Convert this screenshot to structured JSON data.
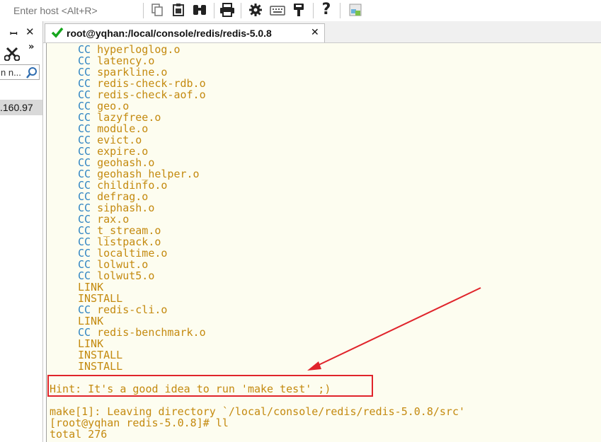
{
  "toolbar": {
    "host_placeholder": "Enter host <Alt+R>",
    "buttons": [
      "copy-icon",
      "paste-icon",
      "find-icon",
      "print-icon",
      "settings-icon",
      "keyboard-icon",
      "keymap-icon",
      "help-icon",
      "lock-screen-icon"
    ]
  },
  "sidebar": {
    "filter_text": "n n...",
    "session_label": ".160.97"
  },
  "tab": {
    "label": "root@yqhan:/local/console/redis/redis-5.0.8",
    "status": "connected",
    "status_color": "#16a61d"
  },
  "terminal": {
    "build_lines": [
      {
        "kind": "CC",
        "target": "hyperloglog.o"
      },
      {
        "kind": "CC",
        "target": "latency.o"
      },
      {
        "kind": "CC",
        "target": "sparkline.o"
      },
      {
        "kind": "CC",
        "target": "redis-check-rdb.o"
      },
      {
        "kind": "CC",
        "target": "redis-check-aof.o"
      },
      {
        "kind": "CC",
        "target": "geo.o"
      },
      {
        "kind": "CC",
        "target": "lazyfree.o"
      },
      {
        "kind": "CC",
        "target": "module.o"
      },
      {
        "kind": "CC",
        "target": "evict.o"
      },
      {
        "kind": "CC",
        "target": "expire.o"
      },
      {
        "kind": "CC",
        "target": "geohash.o"
      },
      {
        "kind": "CC",
        "target": "geohash_helper.o"
      },
      {
        "kind": "CC",
        "target": "childinfo.o"
      },
      {
        "kind": "CC",
        "target": "defrag.o"
      },
      {
        "kind": "CC",
        "target": "siphash.o"
      },
      {
        "kind": "CC",
        "target": "rax.o"
      },
      {
        "kind": "CC",
        "target": "t_stream.o"
      },
      {
        "kind": "CC",
        "target": "listpack.o"
      },
      {
        "kind": "CC",
        "target": "localtime.o"
      },
      {
        "kind": "CC",
        "target": "lolwut.o"
      },
      {
        "kind": "CC",
        "target": "lolwut5.o"
      },
      {
        "kind": "LINK",
        "target": ""
      },
      {
        "kind": "INSTALL",
        "target": ""
      },
      {
        "kind": "CC",
        "target": "redis-cli.o"
      },
      {
        "kind": "LINK",
        "target": ""
      },
      {
        "kind": "CC",
        "target": "redis-benchmark.o"
      },
      {
        "kind": "LINK",
        "target": ""
      },
      {
        "kind": "INSTALL",
        "target": ""
      },
      {
        "kind": "INSTALL",
        "target": ""
      }
    ],
    "hint": "Hint: It's a good idea to run 'make test' ;)",
    "leaving_dir": "make[1]: Leaving directory `/local/console/redis/redis-5.0.8/src'",
    "prompt": "[root@yqhan redis-5.0.8]# ll",
    "total": "total 276",
    "colors": {
      "cc": "#2f84c2",
      "target": "#c48a0f",
      "plain": "#444444",
      "background": "#fdfdf0"
    }
  },
  "annotation": {
    "box_color": "#e0242b",
    "arrow_color": "#e0242b"
  }
}
